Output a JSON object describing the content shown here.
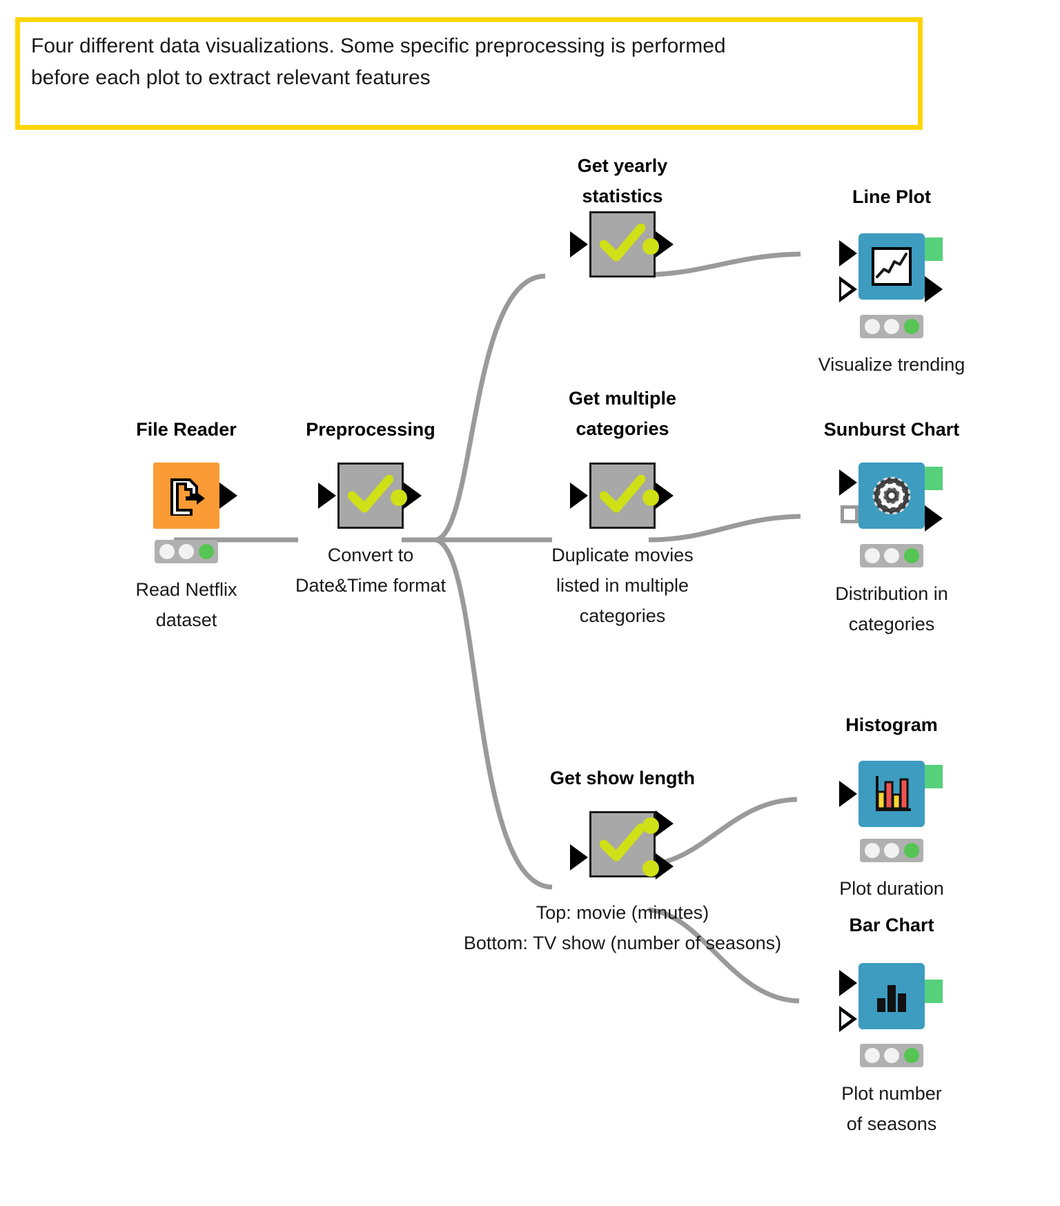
{
  "annotation": {
    "line1": "Four different data visualizations. Some specific preprocessing is performed",
    "line2": "before each plot to extract relevant features",
    "border_color": "#ffd400"
  },
  "colors": {
    "reader_node": "#fa9b35",
    "view_node": "#3d9cc0",
    "metanode": "#a8a8a8",
    "status_green": "#55c553",
    "port_green": "#56d07b",
    "port_yellow": "#cfe016",
    "edge": "#9a9a9a"
  },
  "nodes": [
    {
      "id": "file-reader",
      "title": "File Reader",
      "caption": "Read Netflix\ndataset",
      "kind": "reader",
      "icon": "file-export-icon",
      "status": [
        "off",
        "off",
        "on"
      ]
    },
    {
      "id": "preprocessing",
      "title": "Preprocessing",
      "caption": "Convert to\nDate&Time format",
      "kind": "metanode",
      "icon": "green-check-icon",
      "status": []
    },
    {
      "id": "get-yearly-statistics",
      "title": "Get yearly\nstatistics",
      "caption": "",
      "kind": "metanode",
      "icon": "green-check-icon",
      "status": []
    },
    {
      "id": "line-plot",
      "title": "Line Plot",
      "caption": "Visualize trending",
      "kind": "view",
      "icon": "line-chart-icon",
      "status": [
        "off",
        "off",
        "on"
      ]
    },
    {
      "id": "get-multiple-categories",
      "title": "Get multiple\ncategories",
      "caption": "Duplicate movies\nlisted in multiple\ncategories",
      "kind": "metanode",
      "icon": "green-check-icon",
      "status": []
    },
    {
      "id": "sunburst-chart",
      "title": "Sunburst Chart",
      "caption": "Distribution in\ncategories",
      "kind": "view",
      "icon": "sunburst-icon",
      "status": [
        "off",
        "off",
        "on"
      ]
    },
    {
      "id": "get-show-length",
      "title": "Get show length",
      "caption": "Top: movie (minutes)\nBottom: TV show (number of seasons)",
      "kind": "metanode",
      "icon": "green-check-icon",
      "status": []
    },
    {
      "id": "histogram",
      "title": "Histogram",
      "caption": "Plot duration",
      "kind": "view",
      "icon": "histogram-icon",
      "status": [
        "off",
        "off",
        "on"
      ]
    },
    {
      "id": "bar-chart",
      "title": "Bar Chart",
      "caption": "Plot number\nof seasons",
      "kind": "view",
      "icon": "bar-chart-icon",
      "status": [
        "off",
        "off",
        "on"
      ]
    }
  ],
  "labels": {
    "file_reader_title": "File Reader",
    "file_reader_caption": "Read Netflix\ndataset",
    "preprocessing_title": "Preprocessing",
    "preprocessing_caption": "Convert to\nDate&Time format",
    "yearly_title": "Get yearly\nstatistics",
    "line_plot_title": "Line Plot",
    "line_plot_caption": "Visualize trending",
    "multi_cat_title": "Get multiple\ncategories",
    "multi_cat_caption": "Duplicate movies\nlisted in multiple\ncategories",
    "sunburst_title": "Sunburst Chart",
    "sunburst_caption": "Distribution in\ncategories",
    "show_length_title": "Get show length",
    "show_length_caption_line1": "Top: movie (minutes)",
    "show_length_caption_line2": "Bottom: TV show (number of seasons)",
    "histogram_title": "Histogram",
    "histogram_caption": "Plot duration",
    "bar_chart_title": "Bar Chart",
    "bar_chart_caption": "Plot number\nof seasons"
  }
}
